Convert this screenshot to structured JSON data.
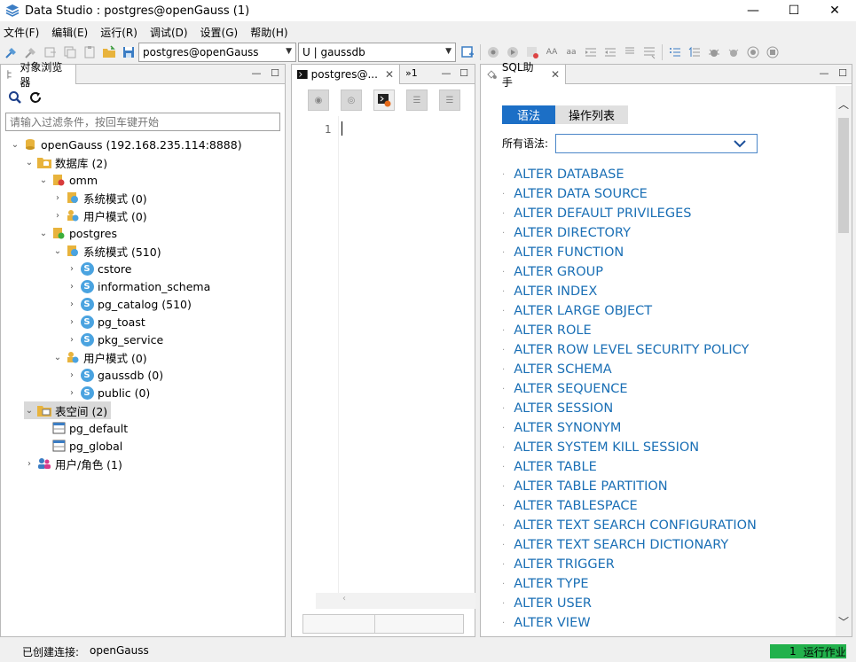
{
  "window": {
    "title": "Data Studio : postgres@openGauss (1)",
    "minimize": "—",
    "maximize": "☐",
    "close": "✕"
  },
  "menu": [
    "文件(F)",
    "编辑(E)",
    "运行(R)",
    "调试(D)",
    "设置(G)",
    "帮助(H)"
  ],
  "toolbar": {
    "connection_combo": "postgres@openGauss",
    "database_combo": "U | gaussdb"
  },
  "object_browser": {
    "tab_label": "对象浏览器",
    "filter_placeholder": "请输入过滤条件，按回车键开始",
    "tree": [
      {
        "label": "openGauss (192.168.235.114:8888)",
        "icon": "server-db-icon"
      },
      {
        "label": "数据库 (2)",
        "icon": "database-folder-icon"
      },
      {
        "label": "omm",
        "icon": "database-disconnected-icon"
      },
      {
        "label": "系统模式 (0)",
        "icon": "system-schema-icon"
      },
      {
        "label": "用户模式 (0)",
        "icon": "user-schema-icon"
      },
      {
        "label": "postgres",
        "icon": "database-connected-icon"
      },
      {
        "label": "系统模式 (510)",
        "icon": "system-schema-icon"
      },
      {
        "label": "cstore",
        "icon": "schema-icon"
      },
      {
        "label": "information_schema",
        "icon": "schema-icon"
      },
      {
        "label": "pg_catalog (510)",
        "icon": "schema-icon"
      },
      {
        "label": "pg_toast",
        "icon": "schema-icon"
      },
      {
        "label": "pkg_service",
        "icon": "schema-icon"
      },
      {
        "label": "用户模式 (0)",
        "icon": "user-schema-icon"
      },
      {
        "label": "gaussdb (0)",
        "icon": "schema-icon"
      },
      {
        "label": "public (0)",
        "icon": "schema-icon"
      },
      {
        "label": "表空间 (2)",
        "icon": "tablespace-folder-icon"
      },
      {
        "label": "pg_default",
        "icon": "tablespace-icon"
      },
      {
        "label": "pg_global",
        "icon": "tablespace-icon"
      },
      {
        "label": "用户/角色 (1)",
        "icon": "users-roles-icon"
      }
    ]
  },
  "editor": {
    "tab_label": "postgres@...",
    "overflow_label": "»1",
    "line_number": "1"
  },
  "sql_helper": {
    "tab_label": "SQL助手",
    "segment_syntax": "语法",
    "segment_operations": "操作列表",
    "all_syntax_label": "所有语法:",
    "syntax_list": [
      "ALTER DATABASE",
      "ALTER DATA SOURCE",
      "ALTER DEFAULT PRIVILEGES",
      "ALTER DIRECTORY",
      "ALTER FUNCTION",
      "ALTER GROUP",
      "ALTER INDEX",
      "ALTER LARGE OBJECT",
      "ALTER ROLE",
      "ALTER ROW LEVEL SECURITY POLICY",
      "ALTER SCHEMA",
      "ALTER SEQUENCE",
      "ALTER SESSION",
      "ALTER SYNONYM",
      "ALTER SYSTEM KILL SESSION",
      "ALTER TABLE",
      "ALTER TABLE PARTITION",
      "ALTER TABLESPACE",
      "ALTER TEXT SEARCH CONFIGURATION",
      "ALTER TEXT SEARCH DICTIONARY",
      "ALTER TRIGGER",
      "ALTER TYPE",
      "ALTER USER",
      "ALTER VIEW"
    ]
  },
  "status_bar": {
    "connection_label": "已创建连接:",
    "connection_value": "openGauss",
    "jobs_count": "1",
    "jobs_label": "运行作业"
  },
  "colors": {
    "accent_blue": "#1a6fb5",
    "segment_active": "#1c6fc6",
    "jobs_green": "#22b14c"
  }
}
